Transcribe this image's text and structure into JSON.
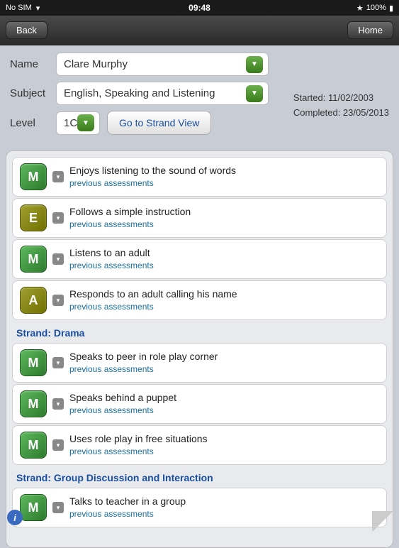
{
  "statusBar": {
    "carrier": "No SIM",
    "time": "09:48",
    "battery": "100%",
    "wifi_icon": "wifi"
  },
  "navBar": {
    "back_label": "Back",
    "home_label": "Home"
  },
  "form": {
    "name_label": "Name",
    "name_value": "Clare Murphy",
    "subject_label": "Subject",
    "subject_value": "English, Speaking and Listening",
    "level_label": "Level",
    "level_value": "1C",
    "started_label": "Started: 11/02/2003",
    "completed_label": "Completed: 23/05/2013",
    "strand_view_btn": "Go to Strand View"
  },
  "assessments": {
    "items": [
      {
        "badge": "M",
        "badge_type": "green",
        "text": "Enjoys listening to the sound of words",
        "link": "previous assessments"
      },
      {
        "badge": "E",
        "badge_type": "olive",
        "text": "Follows a simple instruction",
        "link": "previous assessments"
      },
      {
        "badge": "M",
        "badge_type": "green",
        "text": "Listens to an adult",
        "link": "previous assessments"
      },
      {
        "badge": "A",
        "badge_type": "olive",
        "text": "Responds to an adult calling his name",
        "link": "previous assessments"
      }
    ],
    "drama_label": "Strand: Drama",
    "drama_items": [
      {
        "badge": "M",
        "badge_type": "green",
        "text": "Speaks to peer in role play corner",
        "link": "previous assessments"
      },
      {
        "badge": "M",
        "badge_type": "green",
        "text": "Speaks behind a puppet",
        "link": "previous assessments"
      },
      {
        "badge": "M",
        "badge_type": "green",
        "text": "Uses role play in free situations",
        "link": "previous assessments"
      }
    ],
    "group_label": "Strand: Group Discussion and Interaction",
    "group_items": [
      {
        "badge": "M",
        "badge_type": "green",
        "text": "Talks to teacher in a group",
        "link": "previous assessments"
      }
    ]
  }
}
